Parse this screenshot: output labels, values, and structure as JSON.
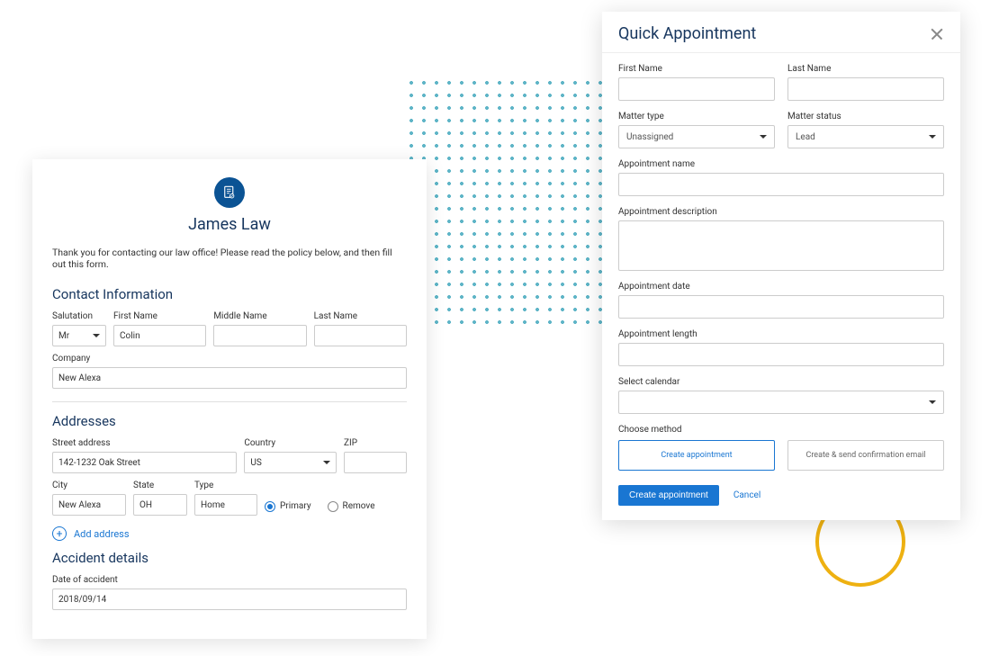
{
  "left": {
    "firm_name": "James Law",
    "intro": "Thank you for contacting our law office! Please read the policy below, and then fill out this form.",
    "sections": {
      "contact": {
        "title": "Contact Information",
        "salutation": {
          "label": "Salutation",
          "value": "Mr"
        },
        "first_name": {
          "label": "First Name",
          "value": "Colin"
        },
        "middle_name": {
          "label": "Middle Name",
          "value": ""
        },
        "last_name": {
          "label": "Last Name",
          "value": ""
        },
        "company": {
          "label": "Company",
          "value": "New Alexa"
        }
      },
      "addresses": {
        "title": "Addresses",
        "street": {
          "label": "Street address",
          "value": "142-1232 Oak Street"
        },
        "country": {
          "label": "Country",
          "value": "US"
        },
        "zip": {
          "label": "ZIP",
          "value": ""
        },
        "city": {
          "label": "City",
          "value": "New Alexa"
        },
        "state": {
          "label": "State",
          "value": "OH"
        },
        "type": {
          "label": "Type",
          "value": "Home"
        },
        "primary": "Primary",
        "remove": "Remove",
        "add_label": "Add address"
      },
      "accident": {
        "title": "Accident details",
        "date": {
          "label": "Date of accident",
          "value": "2018/09/14"
        }
      }
    }
  },
  "right": {
    "title": "Quick Appointment",
    "first_name": {
      "label": "First Name",
      "value": ""
    },
    "last_name": {
      "label": "Last Name",
      "value": ""
    },
    "matter_type": {
      "label": "Matter type",
      "value": "Unassigned"
    },
    "matter_status": {
      "label": "Matter status",
      "value": "Lead"
    },
    "appt_name": {
      "label": "Appointment name",
      "value": ""
    },
    "appt_desc": {
      "label": "Appointment description",
      "value": ""
    },
    "appt_date": {
      "label": "Appointment date",
      "value": ""
    },
    "appt_length": {
      "label": "Appointment length",
      "value": ""
    },
    "calendar": {
      "label": "Select calendar",
      "value": ""
    },
    "method": {
      "label": "Choose method",
      "option1": "Create appointment",
      "option2": "Create & send confirmation email"
    },
    "footer": {
      "create": "Create appointment",
      "cancel": "Cancel"
    }
  }
}
